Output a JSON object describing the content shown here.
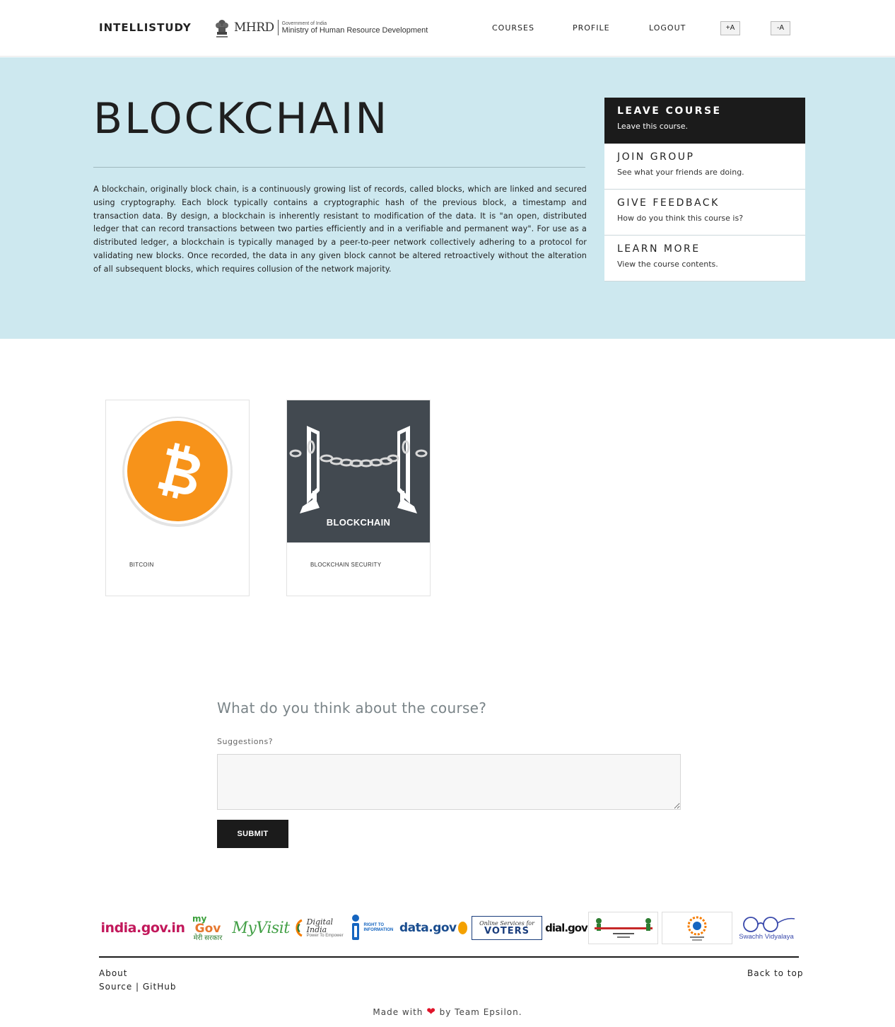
{
  "navbar": {
    "brand": "INTELLISTUDY",
    "mhrd_abbr": "MHRD",
    "mhrd_small": "Government of India",
    "mhrd_ministry": "Ministry of Human Resource Development",
    "links": [
      "COURSES",
      "PROFILE",
      "LOGOUT"
    ],
    "font_increase": "+A",
    "font_decrease": "-A"
  },
  "hero": {
    "title": "BLOCKCHAIN",
    "description": "A blockchain, originally block chain, is a continuously growing list of records, called blocks, which are linked and secured using cryptography. Each block typically contains a cryptographic hash of the previous block, a timestamp and transaction data. By design, a blockchain is inherently resistant to modification of the data. It is \"an open, distributed ledger that can record transactions between two parties efficiently and in a verifiable and permanent way\". For use as a distributed ledger, a blockchain is typically managed by a peer-to-peer network collectively adhering to a protocol for validating new blocks. Once recorded, the data in any given block cannot be altered retroactively without the alteration of all subsequent blocks, which requires collusion of the network majority.",
    "menu": [
      {
        "title": "LEAVE COURSE",
        "subtitle": "Leave this course."
      },
      {
        "title": "JOIN GROUP",
        "subtitle": "See what your friends are doing."
      },
      {
        "title": "GIVE FEEDBACK",
        "subtitle": "How do you think this course is?"
      },
      {
        "title": "LEARN MORE",
        "subtitle": "View the course contents."
      }
    ]
  },
  "courses": [
    {
      "label": "BITCOIN",
      "image_text": ""
    },
    {
      "label": "BLOCKCHAIN SECURITY",
      "image_text": "BLOCKCHAIN"
    }
  ],
  "feedback": {
    "heading": "What do you think about the course?",
    "field_label": "Suggestions?",
    "placeholder": "",
    "submit_label": "SUBMIT"
  },
  "gov_logos": {
    "india_gov": "india.gov.in",
    "mygov_top": "my",
    "mygov_main": "Gov",
    "mygov_sub": "मेरी सरकार",
    "myvisit": "MyVisit",
    "digital_india": "Digital India",
    "digital_india_sub": "Power To Empower",
    "rti_text": "RIGHT TO INFORMATION",
    "data_gov": "data.gov",
    "voters_top": "Online Services for",
    "voters_main": "VOTERS",
    "dial_gov": "dial.gov",
    "swachh": "Swachh Vidyalaya"
  },
  "footer": {
    "about": "About",
    "source": "Source | GitHub",
    "back_to_top": "Back to top",
    "made_with": "Made with",
    "by_team": "by Team Epsilon."
  },
  "colors": {
    "hero_bg": "#cde8ef",
    "dark": "#1b1b1b",
    "bitcoin_orange": "#f7931a",
    "blockchain_bg": "#424950"
  }
}
